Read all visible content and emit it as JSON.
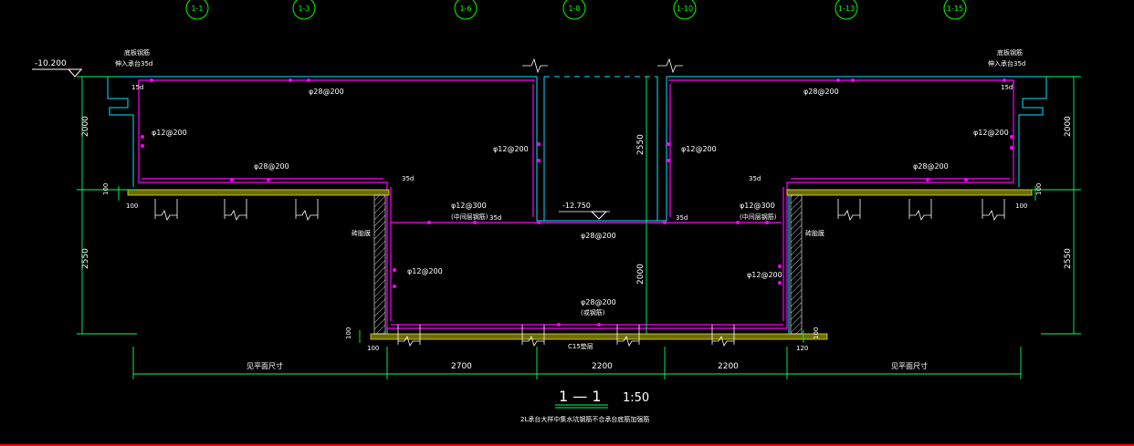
{
  "grid_axes": [
    "1-1",
    "1-3",
    "1-6",
    "1-8",
    "1-10",
    "1-13",
    "1-15"
  ],
  "elevations": {
    "top": "-10.200",
    "pit_bottom": "-12.750"
  },
  "dimensions": {
    "left_upper": "2000",
    "left_lower": "2550",
    "right_upper": "2000",
    "right_lower": "2550",
    "center_upper": "2550",
    "center_lower": "2000",
    "cover_left": "100",
    "cover_right": "100",
    "base_left": "100",
    "base_right": "100",
    "span_1": "2700",
    "span_2": "2200",
    "span_3": "2200",
    "left_extent": "见平面尺寸",
    "right_extent": "见平面尺寸",
    "small_left_a": "100",
    "small_left_b": "100",
    "small_right_a": "100",
    "small_right_b": "120"
  },
  "rebar_labels": {
    "top_left": "φ28@200",
    "top_right": "φ28@200",
    "wall_left": "φ12@200",
    "wall_right": "φ12@200",
    "step_left": "φ28@200",
    "step_right": "φ28@200",
    "pit_wall_left": "φ12@200",
    "pit_wall_right": "φ12@200",
    "mid_left": "φ12@300",
    "mid_right": "φ12@300",
    "mid_left_note": "(中间层钢筋)",
    "mid_right_note": "(中间层钢筋)",
    "center_mid": "φ28@200",
    "lower_wall_left": "φ12@200",
    "lower_wall_right": "φ12@200",
    "bottom": "φ28@200",
    "bottom_note": "(或钢筋)",
    "bottom_cushion": "C15垫层",
    "top_left_note1": "底板钢筋",
    "top_left_note2": "伸入承台35d",
    "top_right_note1": "底板钢筋",
    "top_right_note2": "伸入承台35d",
    "anchor_35d": "35d",
    "anchor_15d": "15d",
    "left_side_label": "砖胎膜",
    "right_side_label": "砖胎膜"
  },
  "title": {
    "section": "1 — 1",
    "scale": "1:50",
    "note": "2L承台大样中集水坑钢筋不合承台底筋加强筋"
  },
  "colors": {
    "background": "#000000",
    "concrete_outline": "#00e5ff",
    "rebar": "#ff00ff",
    "dimension": "#00ff66",
    "text": "#ffffff",
    "hatch": "#e6e600",
    "axis_circle": "#00ff00",
    "bottom_rule": "#ff0000"
  }
}
